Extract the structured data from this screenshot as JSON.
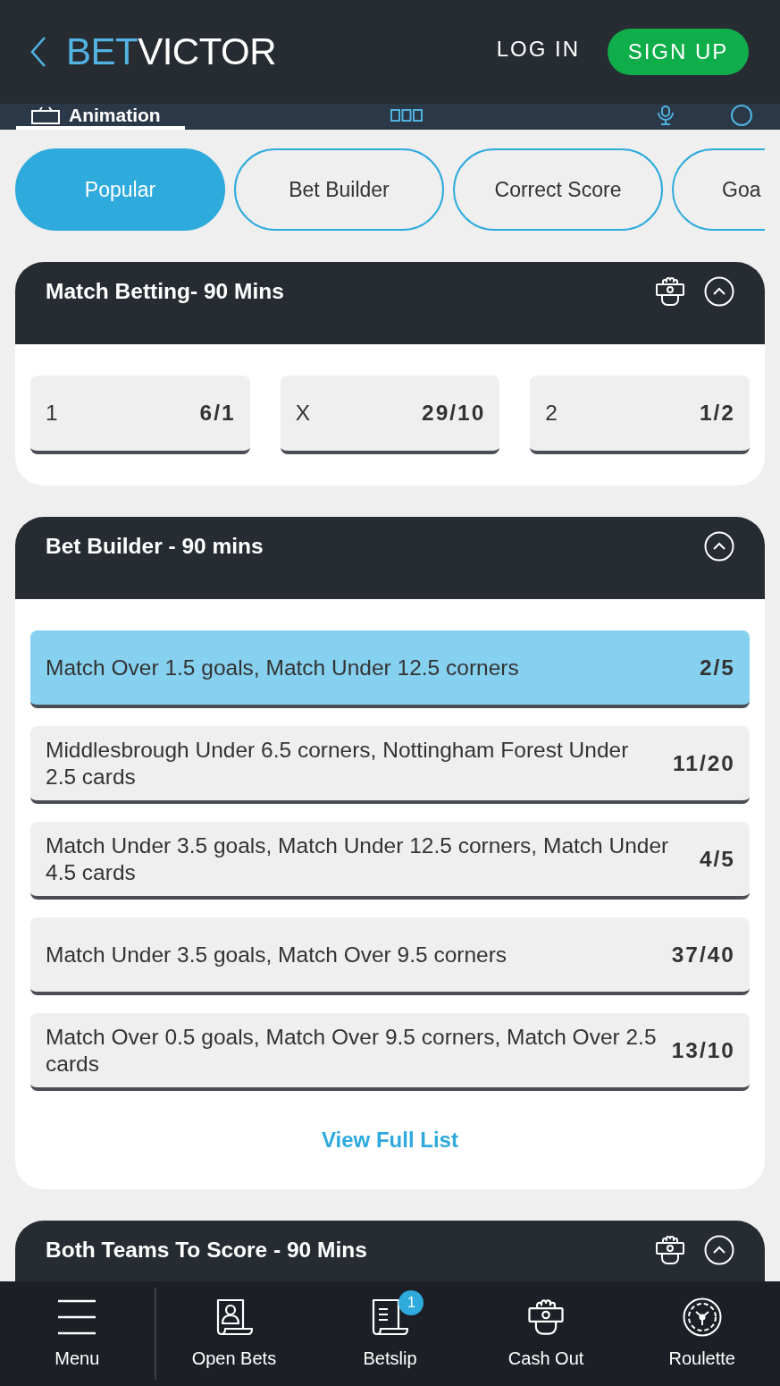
{
  "header": {
    "logo": {
      "part_1": "BET",
      "part_2": "VICTOR"
    },
    "login": "LOG IN",
    "signup": "SIGN UP"
  },
  "subnav": {
    "items": [
      {
        "kind": "animation",
        "label": "Animation",
        "selected": true
      },
      {
        "kind": "stats",
        "selected": false
      },
      {
        "kind": "audio",
        "selected": false
      },
      {
        "kind": "more",
        "selected": false
      }
    ]
  },
  "filters": [
    {
      "label": "Popular",
      "selected": true
    },
    {
      "label": "Bet Builder",
      "selected": false
    },
    {
      "label": "Correct Score",
      "selected": false
    },
    {
      "label": "Goa",
      "selected": false
    }
  ],
  "markets": [
    {
      "kind": "three_way",
      "title": "Match Betting- 90 Mins",
      "cash_out": true,
      "expanded": true,
      "selections": [
        {
          "label": "1",
          "odds": "6/1",
          "selected": false
        },
        {
          "label": "X",
          "odds": "29/10",
          "selected": false
        },
        {
          "label": "2",
          "odds": "1/2",
          "selected": false
        }
      ]
    },
    {
      "kind": "list",
      "title": "Bet Builder - 90 mins",
      "cash_out": false,
      "expanded": true,
      "selections": [
        {
          "label": "Match Over 1.5 goals, Match Under 12.5 corners",
          "odds": "2/5",
          "selected": true
        },
        {
          "label": "Middlesbrough Under 6.5 corners, Nottingham Forest Under 2.5 cards",
          "odds": "11/20",
          "selected": false
        },
        {
          "label": "Match Under 3.5 goals, Match Under 12.5 corners, Match Under 4.5 cards",
          "odds": "4/5",
          "selected": false
        },
        {
          "label": "Match Under 3.5 goals, Match Over 9.5 corners",
          "odds": "37/40",
          "selected": false
        },
        {
          "label": "Match Over 0.5 goals, Match Over 9.5 corners, Match Over 2.5 cards",
          "odds": "13/10",
          "selected": false
        }
      ],
      "more_link": "View Full List"
    },
    {
      "title": "Both Teams To Score - 90 Mins",
      "cash_out": true,
      "expanded": true
    }
  ],
  "bottom_nav": {
    "items": [
      {
        "kind": "menu",
        "label": "Menu"
      },
      {
        "kind": "open_bets",
        "label": "Open Bets"
      },
      {
        "kind": "betslip",
        "label": "Betslip",
        "badge": "1"
      },
      {
        "kind": "cash_out",
        "label": "Cash Out"
      },
      {
        "kind": "roulette",
        "label": "Roulette"
      }
    ]
  }
}
